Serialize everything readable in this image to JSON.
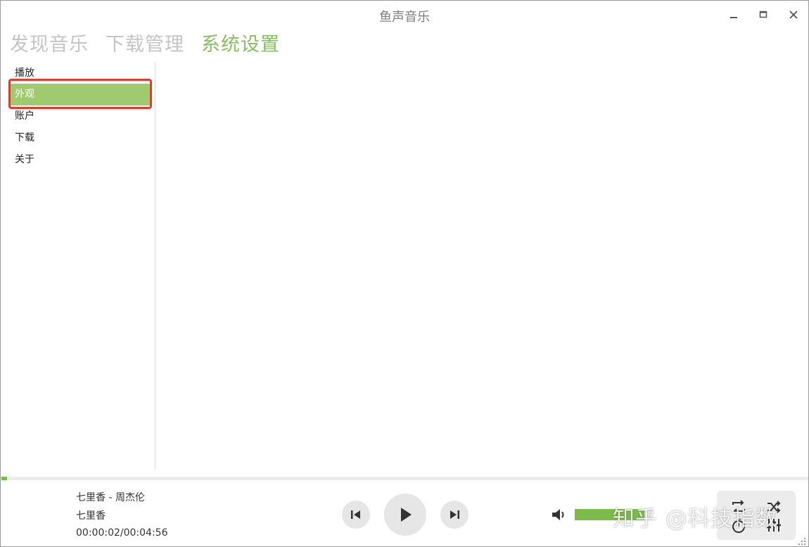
{
  "window": {
    "title": "鱼声音乐"
  },
  "topnav": {
    "tabs": [
      {
        "label": "发现音乐",
        "active": false
      },
      {
        "label": "下载管理",
        "active": false
      },
      {
        "label": "系统设置",
        "active": true
      }
    ]
  },
  "sidebar": {
    "items": [
      {
        "label": "播放",
        "active": false
      },
      {
        "label": "外观",
        "active": true
      },
      {
        "label": "账户",
        "active": false
      },
      {
        "label": "下载",
        "active": false
      },
      {
        "label": "关于",
        "active": false
      }
    ]
  },
  "player": {
    "song_title": "七里香 - 周杰伦",
    "song_name": "七里香",
    "time": "00:00:02/00:04:56",
    "progress_fraction": 0.007,
    "volume_fraction": 0.9
  },
  "watermark": "知乎 @科技指数",
  "colors": {
    "accent": "#86c060",
    "selected_bg": "#9fca6e",
    "highlight_border": "#e23a2c",
    "inactive_tab": "#c4c4c4"
  },
  "icons": {
    "window": [
      "minimize-icon",
      "maximize-icon",
      "close-icon"
    ],
    "player": [
      "previous-icon",
      "play-icon",
      "next-icon",
      "volume-icon"
    ],
    "tools": [
      "repeat-icon",
      "shuffle-icon",
      "timer-icon",
      "equalizer-icon"
    ]
  }
}
